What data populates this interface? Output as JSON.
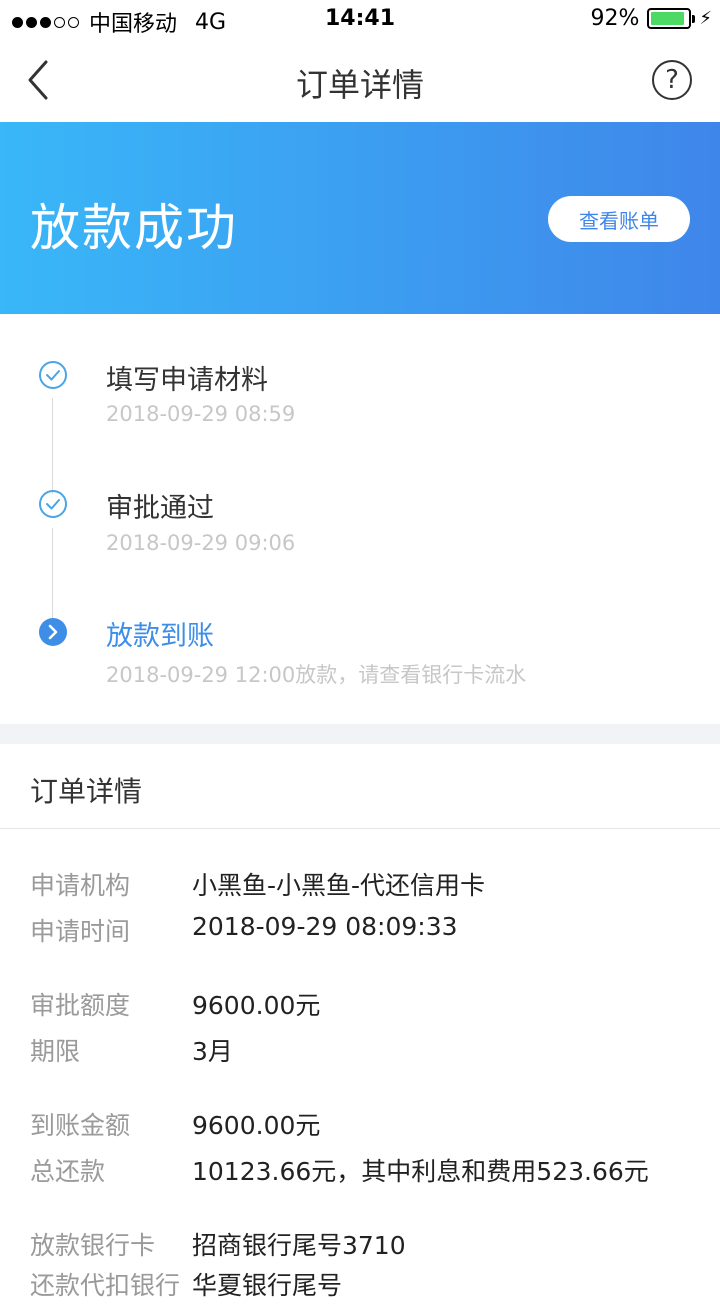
{
  "status_bar": {
    "carrier": "中国移动",
    "network": "4G",
    "time": "14:41",
    "battery": "92%",
    "battery_level": 0.92,
    "signal_bars": 3
  },
  "nav": {
    "title": "订单详情",
    "help_label": "?"
  },
  "banner": {
    "title": "放款成功",
    "button_label": "查看账单",
    "gradient_colors": [
      "#39b7f8",
      "#3f86ea"
    ]
  },
  "timeline": {
    "steps": [
      {
        "title": "填写申请材料",
        "time": "2018-09-29 08:59",
        "state": "done"
      },
      {
        "title": "审批通过",
        "time": "2018-09-29 09:06",
        "state": "done"
      },
      {
        "title": "放款到账",
        "time": "2018-09-29 12:00放款，请查看银行卡流水",
        "state": "current"
      }
    ],
    "accent_color": "#3e8ee8"
  },
  "details": {
    "title": "订单详情",
    "rows": [
      {
        "label": "申请机构",
        "value": "小黑鱼-小黑鱼-代还信用卡"
      },
      {
        "label": "申请时间",
        "value": "2018-09-29 08:09:33"
      },
      {
        "label": "审批额度",
        "value": "9600.00元"
      },
      {
        "label": "期限",
        "value": "3月"
      },
      {
        "label": "到账金额",
        "value": "9600.00元"
      },
      {
        "label": "总还款",
        "value": "10123.66元，其中利息和费用523.66元"
      },
      {
        "label": "放款银行卡",
        "value": "招商银行尾号3710"
      },
      {
        "label": "还款代扣银行",
        "value": "华夏银行尾号"
      }
    ]
  }
}
